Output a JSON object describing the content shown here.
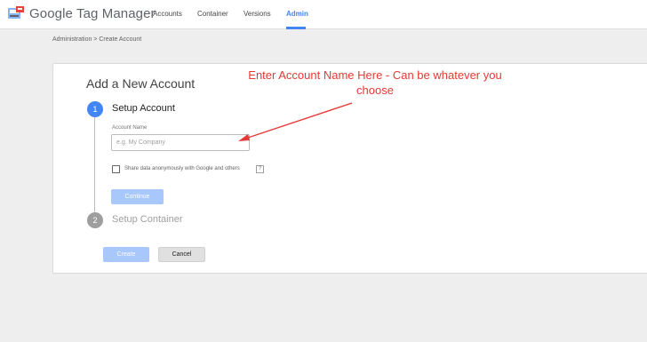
{
  "app": {
    "brand_name": "Google Tag Manager"
  },
  "nav": {
    "items": [
      {
        "label": "Accounts"
      },
      {
        "label": "Container"
      },
      {
        "label": "Versions"
      },
      {
        "label": "Admin",
        "active": true
      }
    ]
  },
  "breadcrumb": "Administration > Create Account",
  "card": {
    "title": "Add a New Account",
    "step1": {
      "number": "1",
      "title": "Setup Account"
    },
    "step2": {
      "number": "2",
      "title": "Setup Container"
    },
    "account_name_label": "Account Name",
    "account_name_value": "",
    "account_name_placeholder": "e.g. My Company",
    "share_data_checked": false,
    "share_data_label": "Share data anonymously with Google and others",
    "help_icon_glyph": "?",
    "continue_label": "Continue",
    "create_label": "Create",
    "cancel_label": "Cancel"
  },
  "annotation": {
    "text": "Enter Account Name Here - Can be whatever you choose",
    "color": "#e53935"
  },
  "colors": {
    "accent": "#4285f4",
    "disabled_button": "#a8c7fa",
    "inactive_step": "#9e9e9e"
  }
}
